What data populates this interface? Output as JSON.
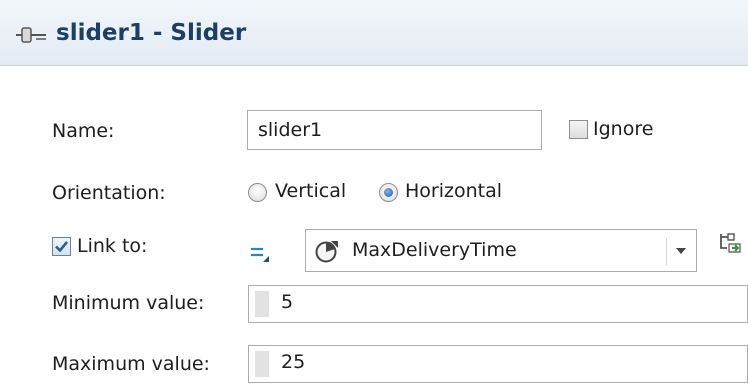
{
  "window": {
    "title": "slider1 - Slider",
    "icon": "slider-icon"
  },
  "form": {
    "name": {
      "label": "Name:",
      "value": "slider1"
    },
    "ignore": {
      "label": "Ignore",
      "checked": false
    },
    "orientation": {
      "label": "Orientation:",
      "options": [
        "Vertical",
        "Horizontal"
      ],
      "selected": "Horizontal"
    },
    "link": {
      "label": "Link to:",
      "checked": true,
      "mode_icon": "equals-icon",
      "value": "MaxDeliveryTime",
      "value_icon": "parameter-icon",
      "action_icon": "create-link-icon"
    },
    "minimum": {
      "label": "Minimum value:",
      "value": "5"
    },
    "maximum": {
      "label": "Maximum value:",
      "value": "25"
    }
  },
  "colors": {
    "title": "#1b3f66",
    "header_bg": "#e8eef5",
    "radio_selected": "#1f5fa8"
  }
}
